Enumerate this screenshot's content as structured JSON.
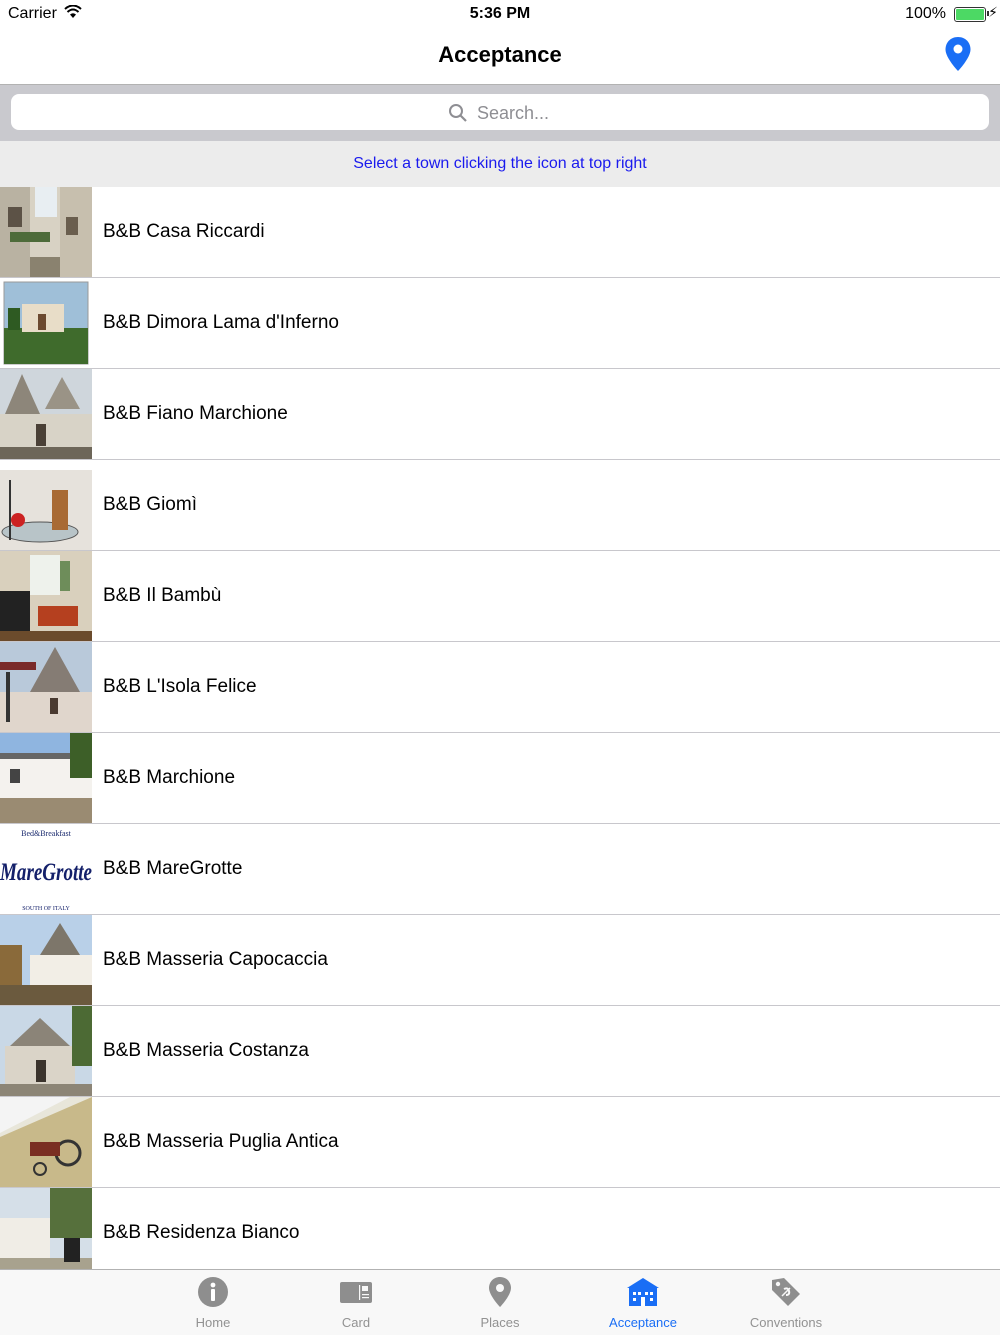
{
  "status_bar": {
    "carrier": "Carrier",
    "time": "5:36 PM",
    "battery": "100%"
  },
  "nav": {
    "title": "Acceptance",
    "location_icon": "map-pin-icon"
  },
  "search": {
    "placeholder": "Search..."
  },
  "hint": "Select a town clicking the icon at top right",
  "items": [
    {
      "label": "B&B Casa Riccardi",
      "thumb": "alley-photo"
    },
    {
      "label": "B&B Dimora Lama d'Inferno",
      "thumb": "villa-photo"
    },
    {
      "label": "B&B Fiano Marchione",
      "thumb": "trulli-photo"
    },
    {
      "label": "B&B Giomì",
      "thumb": "interior-photo"
    },
    {
      "label": "B&B Il Bambù",
      "thumb": "living-room-photo"
    },
    {
      "label": "B&B L'Isola Felice",
      "thumb": "trulli-garden-photo"
    },
    {
      "label": "B&B Marchione",
      "thumb": "house-photo"
    },
    {
      "label": "B&B MareGrotte",
      "thumb": "maregrotte-logo",
      "logo_text": "MareGrotte",
      "logo_top": "Bed&Breakfast",
      "logo_bottom": "SOUTH OF ITALY"
    },
    {
      "label": "B&B Masseria Capocaccia",
      "thumb": "trulli-photo"
    },
    {
      "label": "B&B Masseria Costanza",
      "thumb": "masseria-photo"
    },
    {
      "label": "B&B Masseria Puglia Antica",
      "thumb": "cart-photo"
    },
    {
      "label": "B&B Residenza Bianco",
      "thumb": "garden-photo"
    }
  ],
  "tabs": [
    {
      "label": "Home",
      "icon": "info-icon",
      "active": false
    },
    {
      "label": "Card",
      "icon": "card-icon",
      "active": false
    },
    {
      "label": "Places",
      "icon": "pin-icon",
      "active": false
    },
    {
      "label": "Acceptance",
      "icon": "building-icon",
      "active": true
    },
    {
      "label": "Conventions",
      "icon": "tag-icon",
      "active": false
    }
  ],
  "colors": {
    "accent": "#1a6ef5",
    "hint_text": "#1a1aee",
    "tab_inactive": "#929292"
  }
}
